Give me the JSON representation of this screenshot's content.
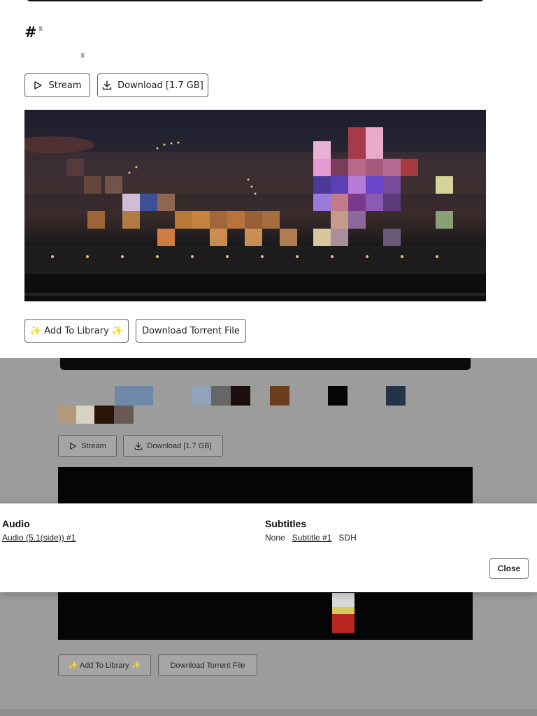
{
  "top": {
    "title": "#",
    "stream_label": "Stream",
    "download_label": "Download [1.7 GB]",
    "add_library_label": "✨ Add To Library ✨",
    "torrent_label": "Download Torrent File"
  },
  "background_page": {
    "stream_label": "Stream",
    "download_label": "Download [1.7 GB]",
    "add_library_label": "✨ Add To Library ✨",
    "torrent_label": "Download Torrent File"
  },
  "modal": {
    "audio_heading": "Audio",
    "audio_tracks": [
      "Audio (5.1(side)) #1"
    ],
    "subtitles_heading": "Subtitles",
    "subtitles_options": {
      "none_label": "None",
      "track_label": "Subtitle #1",
      "sdh_label": "SDH"
    },
    "close_label": "Close"
  },
  "colors": {
    "backdrop": "#9c9c9c",
    "modal_bg": "#ffffff",
    "border": "#666666"
  },
  "icons": {
    "stream": "play-icon",
    "download": "download-icon"
  }
}
